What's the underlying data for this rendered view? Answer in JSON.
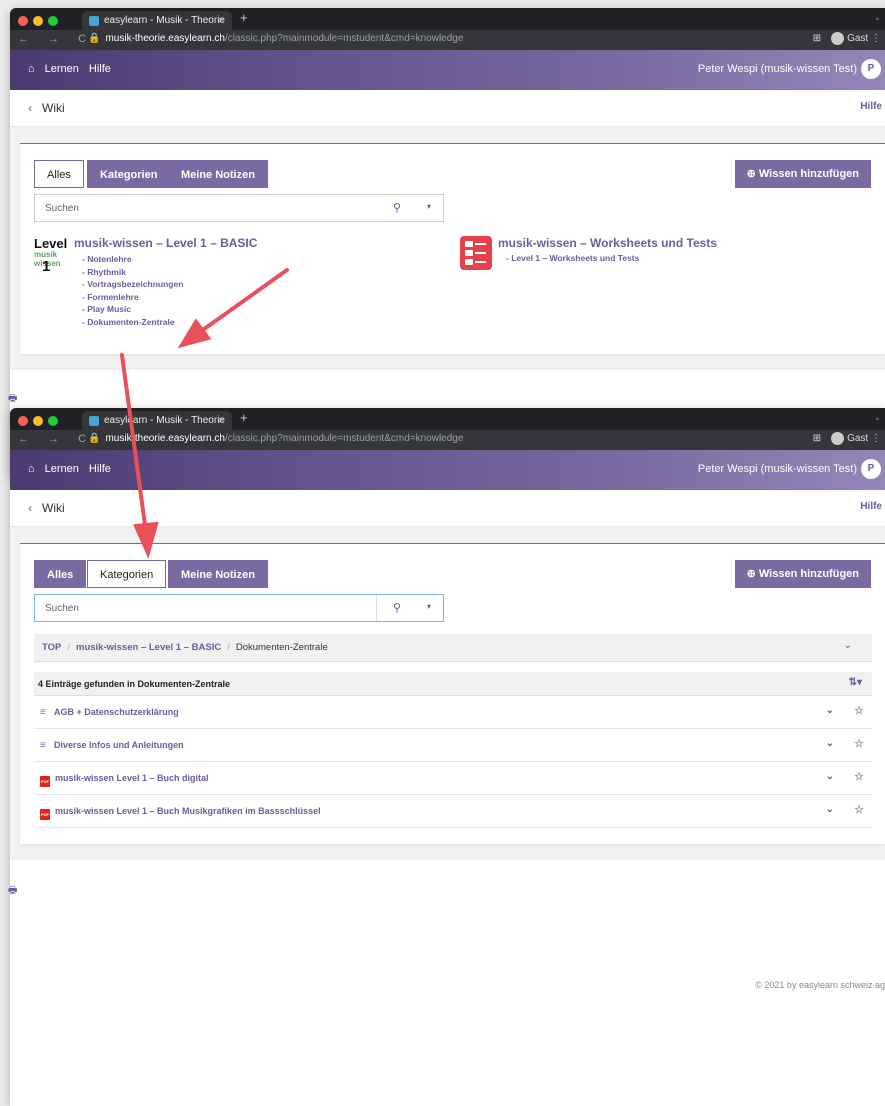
{
  "browser": {
    "tab_title": "easylearn - Musik - Theorie",
    "tab_close": "×",
    "new_tab": "+",
    "nav_glyphs": "← → C",
    "url_host": "musik-theorie.easylearn.ch",
    "url_path": "/classic.php?mainmodule=mstudent&cmd=knowledge",
    "lock": "🔒",
    "translate": "⊞",
    "guest": "Gast",
    "more": "⋮",
    "down": "⌄",
    "dot_colors": [
      "#ff5f56",
      "#ffbd2e",
      "#27c93f"
    ]
  },
  "appbar": {
    "home": "⌂",
    "lernen": "Lernen",
    "hilfe": "Hilfe",
    "user": "Peter Wespi (musik-wissen Test)",
    "avatar": "P"
  },
  "subbar": {
    "back": "‹",
    "title": "Wiki",
    "hilfe": "Hilfe"
  },
  "controls": {
    "alles": "Alles",
    "kategorien": "Kategorien",
    "notizen": "Meine Notizen",
    "add": "Wissen hinzufügen",
    "add_icon": "⊕",
    "search_placeholder": "Suchen",
    "search_icon": "⚲",
    "dropdown": "▾"
  },
  "category1": {
    "icon_level": "Level",
    "icon_num": "1",
    "icon_brand": "musik wissen",
    "title": "musik-wissen – Level 1 – BASIC",
    "items": [
      "- Notenlehre",
      "- Rhythmik",
      "- Vortragsbezeichnungen",
      "- Formenlehre",
      "- Play Music",
      "- Dokumenten-Zentrale"
    ]
  },
  "category2": {
    "title": "musik-wissen – Worksheets und Tests",
    "item": "- Level 1 – Worksheets und Tests"
  },
  "print_icon": "🖶",
  "breadcrumb": {
    "top": "TOP",
    "sep": "/",
    "level": "musik-wissen – Level 1 – BASIC",
    "current": "Dokumenten-Zentrale",
    "toggle": "⌄"
  },
  "list": {
    "header": "4 Einträge gefunden in Dokumenten-Zentrale",
    "sort": "⇅▾",
    "chevron": "⌄",
    "star": "☆",
    "text_icon": "≡",
    "pdf_label": "PDF",
    "rows": [
      {
        "label": "AGB + Datenschutzerklärung",
        "type": "text"
      },
      {
        "label": "Diverse Infos und Anleitungen",
        "type": "text"
      },
      {
        "label": "musik-wissen Level 1 – Buch digital",
        "type": "pdf"
      },
      {
        "label": "musik-wissen Level 1 – Buch Musikgrafiken im Bassschlüssel",
        "type": "pdf"
      }
    ]
  },
  "footer": "© 2021 by easylearn schweiz ag",
  "arrow_color": "#e8505a"
}
